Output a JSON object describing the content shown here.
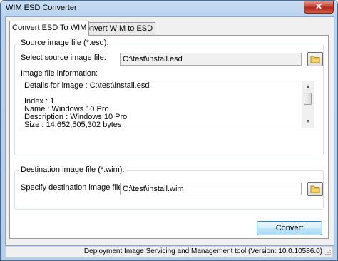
{
  "window": {
    "title": "WIM ESD Converter",
    "close_label": "✕"
  },
  "tabs": [
    {
      "label": "Convert ESD To WIM"
    },
    {
      "label": "Convert WIM to ESD"
    }
  ],
  "source_group": {
    "title": "Source image file (*.esd):",
    "select_label": "Select source image file:",
    "source_path": "C:\\test\\install.esd",
    "info_label": "Image file information:",
    "info_lines": [
      "Details for image : C:\\test\\install.esd",
      "",
      "Index : 1",
      "Name : Windows 10 Pro",
      "Description : Windows 10 Pro",
      "Size : 14,652,505,302 bytes"
    ]
  },
  "destination_group": {
    "title": "Destination image file (*.wim):",
    "specify_label": "Specify destination image file:",
    "destination_path": "C:\\test\\install.wim"
  },
  "convert_button": "Convert",
  "status_bar": "Deployment Image Servicing and Management tool (Version: 10.0.10586.0)",
  "icons": {
    "browse_source": "folder-icon",
    "browse_destination": "folder-icon"
  }
}
